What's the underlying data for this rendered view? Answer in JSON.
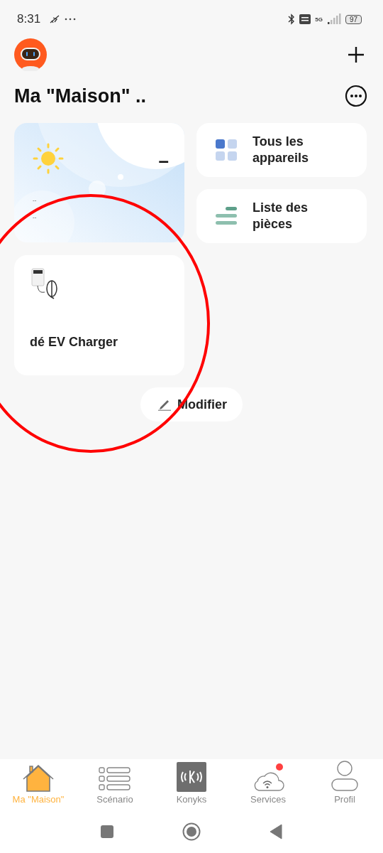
{
  "status_bar": {
    "time": "8:31",
    "network": "5G",
    "battery": "97"
  },
  "header": {
    "title": "Ma \"Maison\" .."
  },
  "weather": {
    "temperature": "–",
    "line_1": "--",
    "line_2": "--"
  },
  "shortcuts": [
    {
      "kind": "grid",
      "label": "Tous les appareils"
    },
    {
      "kind": "list",
      "label": "Liste des pièces"
    }
  ],
  "devices": [
    {
      "name": "dé EV Charger"
    }
  ],
  "edit_button": "Modifier",
  "nav": [
    {
      "kind": "home",
      "label": "Ma \"Maison\"",
      "selected": true,
      "badge": false
    },
    {
      "kind": "scenes",
      "label": "Scénario",
      "selected": false,
      "badge": false
    },
    {
      "kind": "brand",
      "label": "Konyks",
      "selected": false,
      "badge": false
    },
    {
      "kind": "cloud",
      "label": "Services",
      "selected": false,
      "badge": true
    },
    {
      "kind": "profile",
      "label": "Profil",
      "selected": false,
      "badge": false
    }
  ],
  "annotation": {
    "kind": "circle"
  }
}
